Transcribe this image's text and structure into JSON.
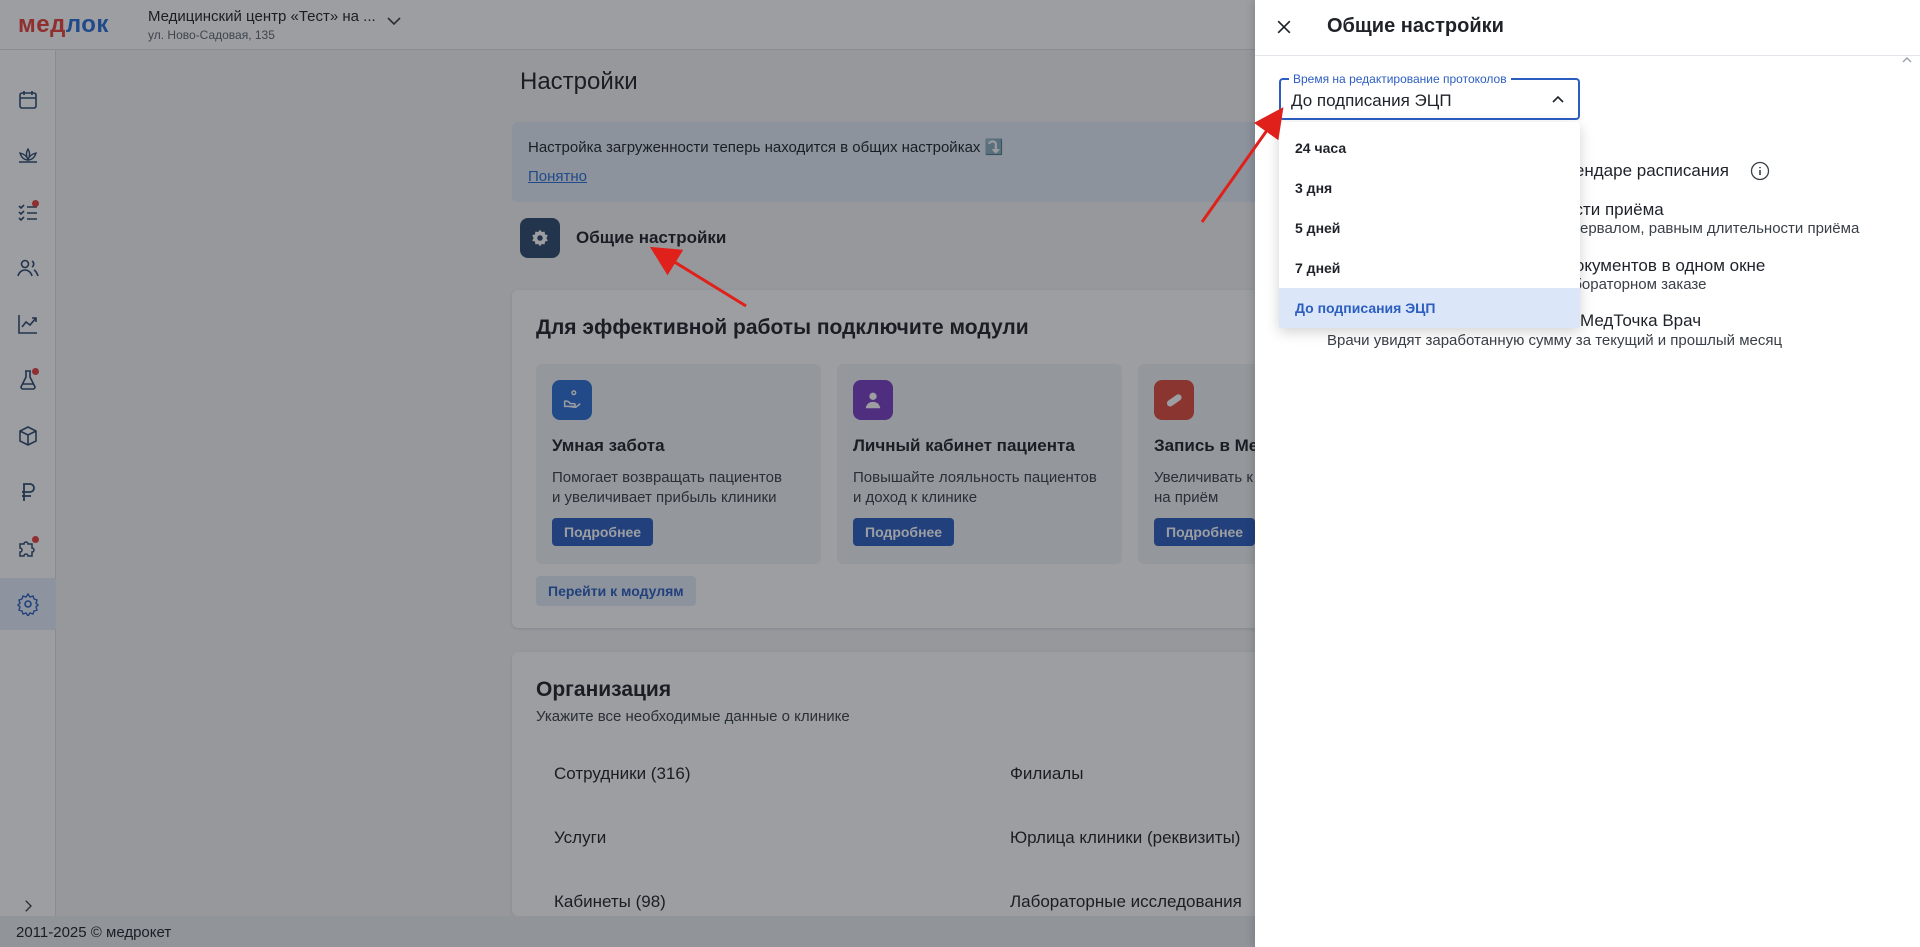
{
  "header": {
    "logo_main": "мед",
    "logo_accent": "лок",
    "clinic_name": "Медицинский центр «Тест» на ...",
    "clinic_address": "ул. Ново-Садовая, 135"
  },
  "sidebar": {
    "items": [
      {
        "icon": "calendar-icon"
      },
      {
        "icon": "lotus-icon"
      },
      {
        "icon": "checklist-icon",
        "badge": true
      },
      {
        "icon": "users-icon"
      },
      {
        "icon": "chart-icon"
      },
      {
        "icon": "flask-icon",
        "badge": true
      },
      {
        "icon": "box-icon"
      },
      {
        "icon": "ruble-icon"
      },
      {
        "icon": "puzzle-icon",
        "badge": true
      },
      {
        "icon": "gear-icon",
        "active": true
      }
    ],
    "expand_icon": "chevron-right-icon"
  },
  "main": {
    "title": "Настройки",
    "notice": {
      "text": "Настройка загруженности теперь находится в общих настройках ⤵️",
      "link": "Понятно"
    },
    "general_settings_label": "Общие настройки",
    "modules": {
      "title": "Для эффективной работы подключите модули",
      "items": [
        {
          "title": "Умная забота",
          "desc_line1": "Помогает возвращать пациентов",
          "desc_line2": "и увеличивает прибыль клиники",
          "button": "Подробнее",
          "color": "#2f6fd4"
        },
        {
          "title": "Личный кабинет пациента",
          "desc_line1": "Повышайте лояльность пациентов",
          "desc_line2": "и доход к клинике",
          "button": "Подробнее",
          "color": "#7b3fc4"
        },
        {
          "title": "Запись в Ме",
          "desc_line1": "Увеличивать к",
          "desc_line2": "на приём",
          "button": "Подробнее",
          "color": "#e04a3c"
        }
      ],
      "all_button": "Перейти к модулям"
    },
    "organization": {
      "title": "Организация",
      "subtitle": "Укажите все необходимые данные о клинике",
      "links_left": [
        "Сотрудники (316)",
        "Услуги",
        "Кабинеты (98)"
      ],
      "links_right": [
        "Филиалы",
        "Юрлица клиники (реквизиты)",
        "Лабораторные исследования"
      ]
    }
  },
  "footer": {
    "text": "2011-2025 © медрокет"
  },
  "drawer": {
    "title": "Общие настройки",
    "select": {
      "label": "Время на редактирование протоколов",
      "value": "До подписания ЭЦП"
    },
    "options": [
      "24 часа",
      "3 дня",
      "5 дней",
      "7 дней",
      "До подписания ЭЦП"
    ],
    "selected_index": 4,
    "partial_settings": {
      "line1": "лендаре расписания",
      "line2_title": "ости приёма",
      "line2_sub": "нтервалом, равным длительности приёма",
      "line3_title": "документов в одном окне",
      "line3_sub": "абораторном заказе",
      "line4_title": "МедТочка Врач",
      "line4_sub": "Врачи увидят заработанную сумму за текущий и прошлый месяц"
    }
  },
  "colors": {
    "accent": "#2c5ec0",
    "logo_red": "#e8413c",
    "annotation_arrow": "#e0201b"
  }
}
